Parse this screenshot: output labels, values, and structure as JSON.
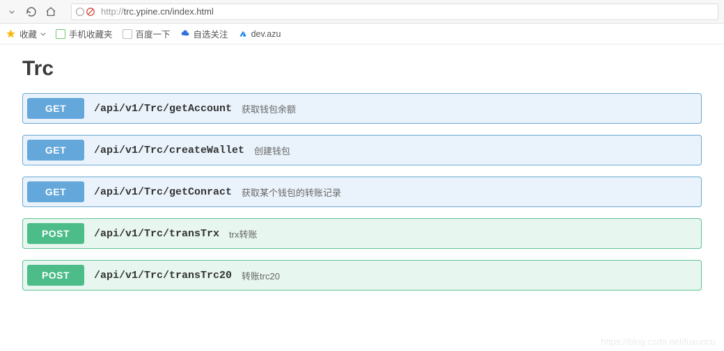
{
  "browser": {
    "url_proto": "http://",
    "url_rest": "trc.ypine.cn/index.html"
  },
  "bookmarks": {
    "fav_label": "收藏",
    "items": [
      {
        "label": "手机收藏夹"
      },
      {
        "label": "百度一下"
      },
      {
        "label": "自选关注"
      },
      {
        "label": "dev.azu"
      }
    ]
  },
  "page": {
    "title": "Trc",
    "endpoints": [
      {
        "method": "GET",
        "path": "/api/v1/Trc/getAccount",
        "desc": "获取钱包余额"
      },
      {
        "method": "GET",
        "path": "/api/v1/Trc/createWallet",
        "desc": "创建钱包"
      },
      {
        "method": "GET",
        "path": "/api/v1/Trc/getConract",
        "desc": "获取某个钱包的转账记录"
      },
      {
        "method": "POST",
        "path": "/api/v1/Trc/transTrx",
        "desc": "trx转账"
      },
      {
        "method": "POST",
        "path": "/api/v1/Trc/transTrc20",
        "desc": "转账trc20"
      }
    ]
  },
  "watermark": "https://blog.csdn.net/luxuncu"
}
